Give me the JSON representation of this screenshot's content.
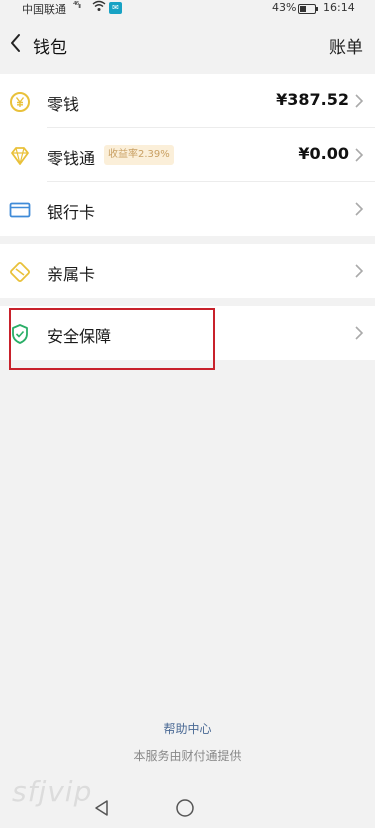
{
  "status_bar": {
    "carrier": "中国联通",
    "signal": "⁴⁶ᵢₗₗ",
    "battery_pct": "43%",
    "time": "16:14"
  },
  "header": {
    "title": "钱包",
    "right_action": "账单"
  },
  "wallet_items": [
    {
      "label": "零钱",
      "value": "¥387.52",
      "icon": "yuan-coin-icon"
    },
    {
      "label": "零钱通",
      "badge": "收益率2.39%",
      "value": "¥0.00",
      "icon": "diamond-icon"
    },
    {
      "label": "银行卡",
      "icon": "bank-card-icon"
    }
  ],
  "other_items": [
    {
      "label": "亲属卡",
      "icon": "family-card-icon"
    }
  ],
  "security_items": [
    {
      "label": "安全保障",
      "icon": "shield-check-icon"
    }
  ],
  "footer": {
    "help_link": "帮助中心",
    "service_note": "本服务由财付通提供"
  },
  "watermark": "sfjvip",
  "colors": {
    "accent_yellow": "#e9c13a",
    "card_blue": "#3f8bd8",
    "shield_green": "#2aae67",
    "highlight_red": "#c8212b",
    "link_blue": "#4b6a95"
  }
}
